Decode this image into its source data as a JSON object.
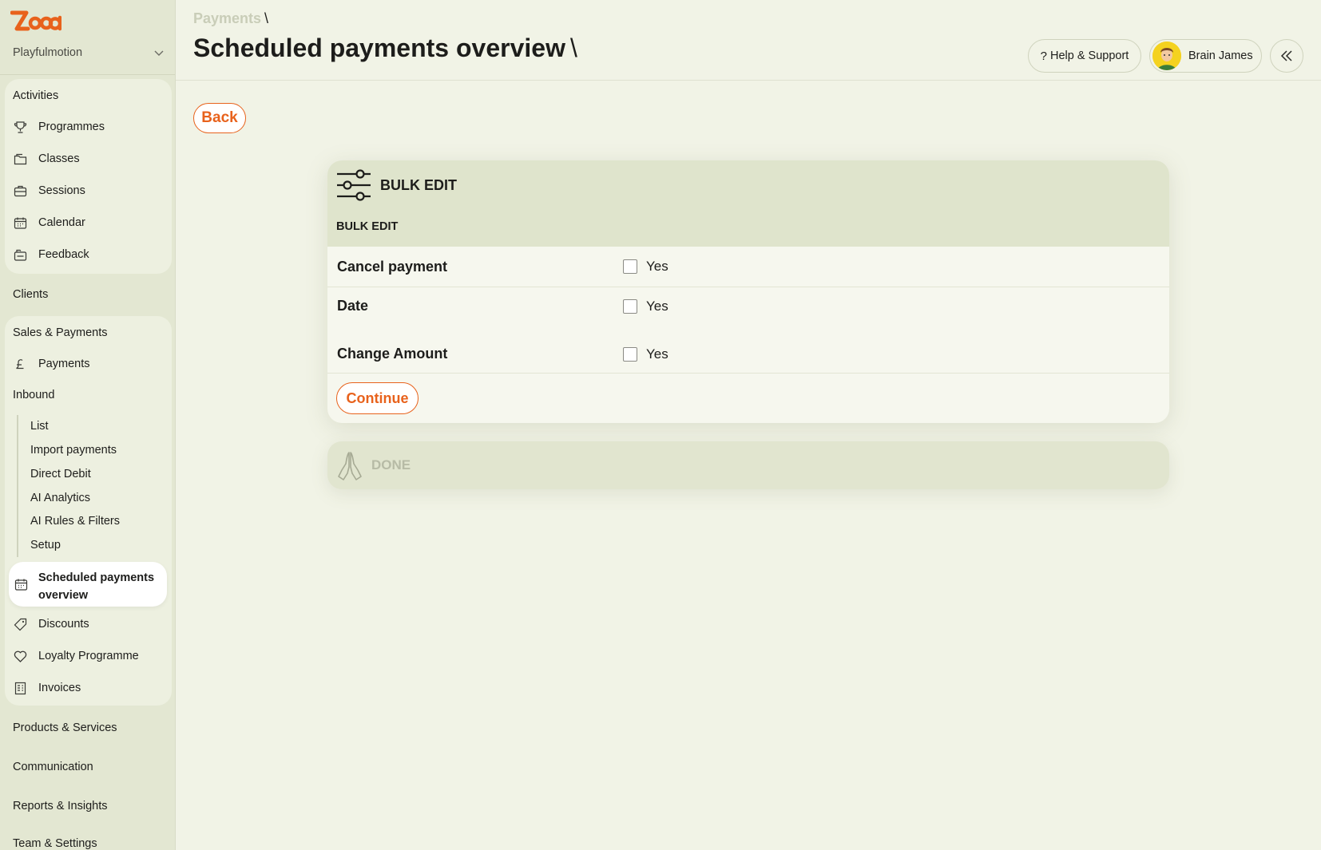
{
  "brand": {
    "logo_text": "zoola",
    "accent_color": "#e8621c"
  },
  "org": {
    "name": "Playfulmotion"
  },
  "sidebar": {
    "activities": {
      "title": "Activities",
      "items": [
        {
          "label": "Programmes",
          "icon": "trophy-icon"
        },
        {
          "label": "Classes",
          "icon": "folder-icon"
        },
        {
          "label": "Sessions",
          "icon": "briefcase-icon"
        },
        {
          "label": "Calendar",
          "icon": "calendar-icon"
        },
        {
          "label": "Feedback",
          "icon": "feedback-icon"
        }
      ]
    },
    "clients": "Clients",
    "sales": {
      "title": "Sales & Payments",
      "payments": "Payments",
      "inbound": "Inbound",
      "sub_items": [
        "List",
        "Import payments",
        "Direct Debit",
        "AI Analytics",
        "AI Rules & Filters",
        "Setup"
      ],
      "active": "Scheduled payments overview",
      "items": [
        {
          "label": "Discounts",
          "icon": "tag-icon"
        },
        {
          "label": "Loyalty Programme",
          "icon": "heart-icon"
        },
        {
          "label": "Invoices",
          "icon": "invoice-icon"
        }
      ]
    },
    "products": "Products & Services",
    "communication": "Communication",
    "reports": "Reports & Insights",
    "team": "Team & Settings"
  },
  "header": {
    "breadcrumb": "Payments",
    "separator": "\\",
    "title": "Scheduled payments overview",
    "help": "Help & Support",
    "user": "Brain James"
  },
  "main": {
    "back": "Back",
    "bulk": {
      "title": "BULK EDIT",
      "subtitle": "BULK EDIT",
      "rows": [
        {
          "label": "Cancel payment",
          "option": "Yes",
          "checked": false
        },
        {
          "label": "Date",
          "option": "Yes",
          "checked": false
        },
        {
          "label": "Change Amount",
          "option": "Yes",
          "checked": false
        }
      ],
      "continue": "Continue"
    },
    "done": {
      "title": "DONE"
    }
  }
}
